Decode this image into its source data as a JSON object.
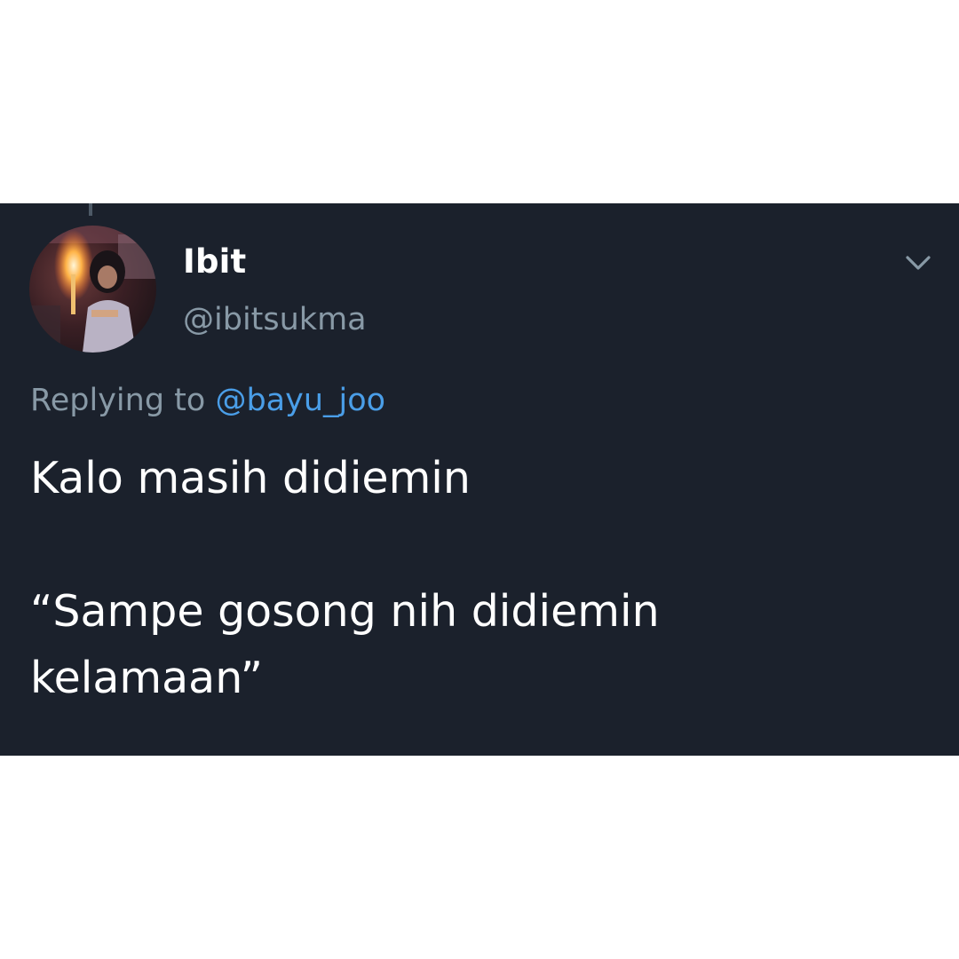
{
  "author": {
    "display_name": "Ibit",
    "handle": "@ibitsukma",
    "avatar_icon": "profile-photo-candle"
  },
  "reply": {
    "prefix": "Replying to",
    "to_handle": "@bayu_joo"
  },
  "tweet": {
    "line1": "Kalo masih didiemin",
    "line2": "“Sampe gosong nih didiemin",
    "line3": "kelamaan”"
  },
  "menu": {
    "icon": "chevron-down-icon"
  },
  "colors": {
    "card_background": "#1b212c",
    "page_background": "#ffffff",
    "primary_text": "#ffffff",
    "secondary_text": "#8899a6",
    "link": "#4a9ee8"
  }
}
